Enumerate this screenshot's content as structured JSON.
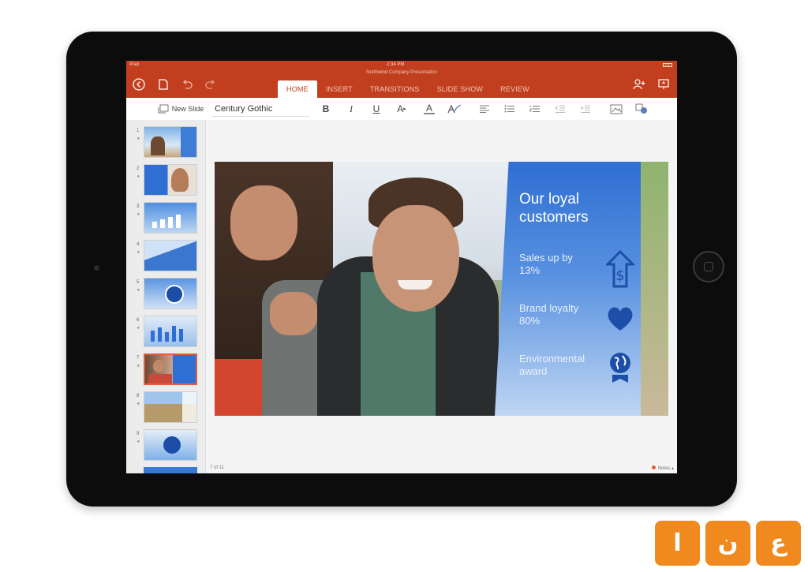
{
  "status": {
    "carrier": "iPad",
    "time": "2:34 PM"
  },
  "window": {
    "document_title": "Northwind Company Presentation"
  },
  "ribbon": {
    "tabs": [
      {
        "label": "HOME",
        "active": true
      },
      {
        "label": "INSERT",
        "active": false
      },
      {
        "label": "TRANSITIONS",
        "active": false
      },
      {
        "label": "SLIDE SHOW",
        "active": false
      },
      {
        "label": "REVIEW",
        "active": false
      }
    ],
    "left_icons": [
      "back-arrow-icon",
      "file-icon",
      "undo-icon",
      "redo-icon"
    ],
    "right_icons": [
      "share-person-icon",
      "present-icon"
    ],
    "accent": "#c13f1f"
  },
  "toolbar": {
    "new_slide_label": "New Slide",
    "font_name": "Century Gothic",
    "bold": "B",
    "italic": "I",
    "underline": "U",
    "font_size_glyph": "A",
    "font_color_glyph": "A"
  },
  "slides": [
    {
      "number": "1",
      "star": "★"
    },
    {
      "number": "2",
      "star": "★"
    },
    {
      "number": "3",
      "star": "★"
    },
    {
      "number": "4",
      "star": "★"
    },
    {
      "number": "5",
      "star": "★"
    },
    {
      "number": "6",
      "star": "★"
    },
    {
      "number": "7",
      "star": "★",
      "selected": true
    },
    {
      "number": "8",
      "star": "★"
    },
    {
      "number": "9",
      "star": "★"
    }
  ],
  "slide": {
    "heading": "Our loyal customers",
    "points": [
      {
        "text": "Sales up by 13%",
        "icon": "dollar-arrow-icon"
      },
      {
        "text": "Brand loyalty 80%",
        "icon": "heart-icon"
      },
      {
        "text": "Environmental award",
        "icon": "globe-award-icon"
      }
    ],
    "panel_color": "#2f6fd3"
  },
  "footer": {
    "slide_counter": "7 of 11",
    "notes_label": "Notes"
  },
  "watermark": {
    "tiles": [
      "ع",
      "ن",
      "ا"
    ]
  }
}
